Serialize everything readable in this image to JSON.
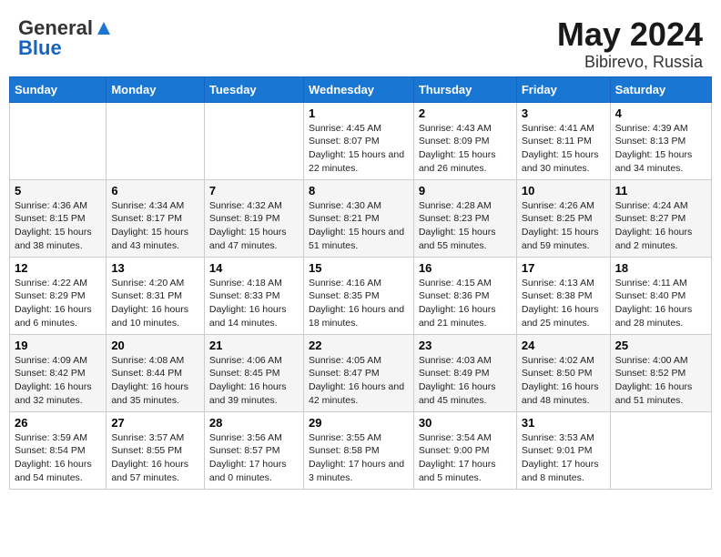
{
  "header": {
    "logo_general": "General",
    "logo_blue": "Blue",
    "month": "May 2024",
    "location": "Bibirevo, Russia"
  },
  "days_of_week": [
    "Sunday",
    "Monday",
    "Tuesday",
    "Wednesday",
    "Thursday",
    "Friday",
    "Saturday"
  ],
  "weeks": [
    [
      {
        "day": "",
        "info": ""
      },
      {
        "day": "",
        "info": ""
      },
      {
        "day": "",
        "info": ""
      },
      {
        "day": "1",
        "sunrise": "Sunrise: 4:45 AM",
        "sunset": "Sunset: 8:07 PM",
        "daylight": "Daylight: 15 hours and 22 minutes."
      },
      {
        "day": "2",
        "sunrise": "Sunrise: 4:43 AM",
        "sunset": "Sunset: 8:09 PM",
        "daylight": "Daylight: 15 hours and 26 minutes."
      },
      {
        "day": "3",
        "sunrise": "Sunrise: 4:41 AM",
        "sunset": "Sunset: 8:11 PM",
        "daylight": "Daylight: 15 hours and 30 minutes."
      },
      {
        "day": "4",
        "sunrise": "Sunrise: 4:39 AM",
        "sunset": "Sunset: 8:13 PM",
        "daylight": "Daylight: 15 hours and 34 minutes."
      }
    ],
    [
      {
        "day": "5",
        "sunrise": "Sunrise: 4:36 AM",
        "sunset": "Sunset: 8:15 PM",
        "daylight": "Daylight: 15 hours and 38 minutes."
      },
      {
        "day": "6",
        "sunrise": "Sunrise: 4:34 AM",
        "sunset": "Sunset: 8:17 PM",
        "daylight": "Daylight: 15 hours and 43 minutes."
      },
      {
        "day": "7",
        "sunrise": "Sunrise: 4:32 AM",
        "sunset": "Sunset: 8:19 PM",
        "daylight": "Daylight: 15 hours and 47 minutes."
      },
      {
        "day": "8",
        "sunrise": "Sunrise: 4:30 AM",
        "sunset": "Sunset: 8:21 PM",
        "daylight": "Daylight: 15 hours and 51 minutes."
      },
      {
        "day": "9",
        "sunrise": "Sunrise: 4:28 AM",
        "sunset": "Sunset: 8:23 PM",
        "daylight": "Daylight: 15 hours and 55 minutes."
      },
      {
        "day": "10",
        "sunrise": "Sunrise: 4:26 AM",
        "sunset": "Sunset: 8:25 PM",
        "daylight": "Daylight: 15 hours and 59 minutes."
      },
      {
        "day": "11",
        "sunrise": "Sunrise: 4:24 AM",
        "sunset": "Sunset: 8:27 PM",
        "daylight": "Daylight: 16 hours and 2 minutes."
      }
    ],
    [
      {
        "day": "12",
        "sunrise": "Sunrise: 4:22 AM",
        "sunset": "Sunset: 8:29 PM",
        "daylight": "Daylight: 16 hours and 6 minutes."
      },
      {
        "day": "13",
        "sunrise": "Sunrise: 4:20 AM",
        "sunset": "Sunset: 8:31 PM",
        "daylight": "Daylight: 16 hours and 10 minutes."
      },
      {
        "day": "14",
        "sunrise": "Sunrise: 4:18 AM",
        "sunset": "Sunset: 8:33 PM",
        "daylight": "Daylight: 16 hours and 14 minutes."
      },
      {
        "day": "15",
        "sunrise": "Sunrise: 4:16 AM",
        "sunset": "Sunset: 8:35 PM",
        "daylight": "Daylight: 16 hours and 18 minutes."
      },
      {
        "day": "16",
        "sunrise": "Sunrise: 4:15 AM",
        "sunset": "Sunset: 8:36 PM",
        "daylight": "Daylight: 16 hours and 21 minutes."
      },
      {
        "day": "17",
        "sunrise": "Sunrise: 4:13 AM",
        "sunset": "Sunset: 8:38 PM",
        "daylight": "Daylight: 16 hours and 25 minutes."
      },
      {
        "day": "18",
        "sunrise": "Sunrise: 4:11 AM",
        "sunset": "Sunset: 8:40 PM",
        "daylight": "Daylight: 16 hours and 28 minutes."
      }
    ],
    [
      {
        "day": "19",
        "sunrise": "Sunrise: 4:09 AM",
        "sunset": "Sunset: 8:42 PM",
        "daylight": "Daylight: 16 hours and 32 minutes."
      },
      {
        "day": "20",
        "sunrise": "Sunrise: 4:08 AM",
        "sunset": "Sunset: 8:44 PM",
        "daylight": "Daylight: 16 hours and 35 minutes."
      },
      {
        "day": "21",
        "sunrise": "Sunrise: 4:06 AM",
        "sunset": "Sunset: 8:45 PM",
        "daylight": "Daylight: 16 hours and 39 minutes."
      },
      {
        "day": "22",
        "sunrise": "Sunrise: 4:05 AM",
        "sunset": "Sunset: 8:47 PM",
        "daylight": "Daylight: 16 hours and 42 minutes."
      },
      {
        "day": "23",
        "sunrise": "Sunrise: 4:03 AM",
        "sunset": "Sunset: 8:49 PM",
        "daylight": "Daylight: 16 hours and 45 minutes."
      },
      {
        "day": "24",
        "sunrise": "Sunrise: 4:02 AM",
        "sunset": "Sunset: 8:50 PM",
        "daylight": "Daylight: 16 hours and 48 minutes."
      },
      {
        "day": "25",
        "sunrise": "Sunrise: 4:00 AM",
        "sunset": "Sunset: 8:52 PM",
        "daylight": "Daylight: 16 hours and 51 minutes."
      }
    ],
    [
      {
        "day": "26",
        "sunrise": "Sunrise: 3:59 AM",
        "sunset": "Sunset: 8:54 PM",
        "daylight": "Daylight: 16 hours and 54 minutes."
      },
      {
        "day": "27",
        "sunrise": "Sunrise: 3:57 AM",
        "sunset": "Sunset: 8:55 PM",
        "daylight": "Daylight: 16 hours and 57 minutes."
      },
      {
        "day": "28",
        "sunrise": "Sunrise: 3:56 AM",
        "sunset": "Sunset: 8:57 PM",
        "daylight": "Daylight: 17 hours and 0 minutes."
      },
      {
        "day": "29",
        "sunrise": "Sunrise: 3:55 AM",
        "sunset": "Sunset: 8:58 PM",
        "daylight": "Daylight: 17 hours and 3 minutes."
      },
      {
        "day": "30",
        "sunrise": "Sunrise: 3:54 AM",
        "sunset": "Sunset: 9:00 PM",
        "daylight": "Daylight: 17 hours and 5 minutes."
      },
      {
        "day": "31",
        "sunrise": "Sunrise: 3:53 AM",
        "sunset": "Sunset: 9:01 PM",
        "daylight": "Daylight: 17 hours and 8 minutes."
      },
      {
        "day": "",
        "info": ""
      }
    ]
  ]
}
